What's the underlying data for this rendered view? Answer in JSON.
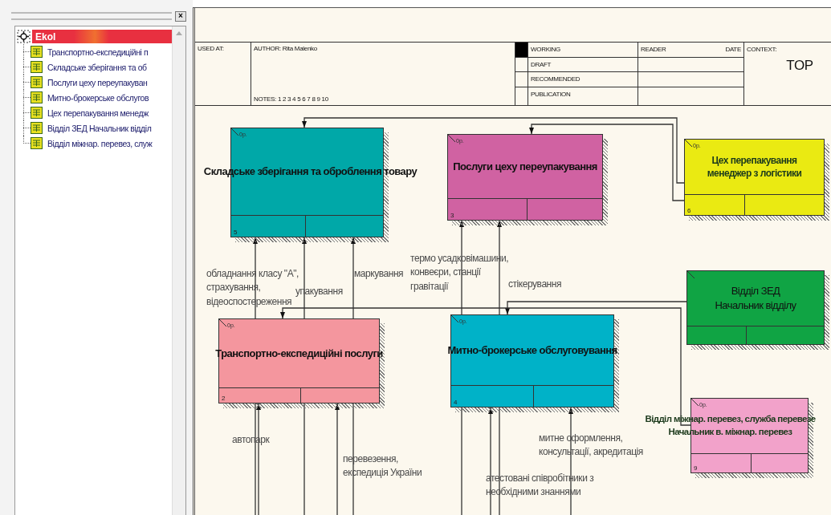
{
  "panel": {
    "close_glyph": "×"
  },
  "tree": {
    "root": {
      "label": "Ekol",
      "selected": true
    },
    "items": [
      {
        "label": "Транспортно-експедиційні п",
        "selected": false
      },
      {
        "label": "Складське зберігання та об",
        "selected": false
      },
      {
        "label": "Послуги цеху переупакуван",
        "selected": false
      },
      {
        "label": "Митно-брокерське обслугов",
        "selected": false
      },
      {
        "label": "Цех перепакування менедж",
        "selected": false
      },
      {
        "label": "Відділ ЗЕД Начальник відділ",
        "selected": false
      },
      {
        "label": "Відділ міжнар. перевез, служ",
        "selected": false
      }
    ]
  },
  "header": {
    "used_at": "USED AT:",
    "author": "AUTHOR:  Rita Malenko",
    "notes": "NOTES:  1 2 3 4 5 6 7 8 9 10",
    "statuses": [
      {
        "label": "WORKING",
        "selected": true
      },
      {
        "label": "DRAFT",
        "selected": false
      },
      {
        "label": "RECOMMENDED",
        "selected": false
      },
      {
        "label": "PUBLICATION",
        "selected": false
      }
    ],
    "reader": "READER",
    "date": "DATE",
    "context": "CONTEXT:",
    "context_value": "TOP"
  },
  "boxes": [
    {
      "title": "Складське зберігання та оброблення товару",
      "ref": "0р.",
      "number": "5",
      "color": "#00a8a8",
      "emphasis": true
    },
    {
      "title": "Послуги цеху переупакування",
      "ref": "0р.",
      "number": "3",
      "color": "#d062a2",
      "emphasis": true
    },
    {
      "title": "Цех перепакування\nменеджер з логістики",
      "ref": "0р.",
      "number": "6",
      "color": "#eaea12",
      "emphasis": true
    },
    {
      "title": "Відділ ЗЕД\nНачальник відділу",
      "color": "#10a444",
      "emphasis": false
    },
    {
      "title": "Транспортно-експедиційні послуги",
      "ref": "0р.",
      "number": "2",
      "color": "#f4969e",
      "emphasis": true
    },
    {
      "title": "Митно-брокерське обслуговування",
      "ref": "0р.",
      "number": "4",
      "color": "#00b2c8",
      "emphasis": true
    },
    {
      "title": "Відділ міжнар. перевез, служба перевезе\nНачальник в. міжнар. перевез",
      "ref": "0р.",
      "number": "9",
      "color": "#f2a2ca",
      "emphasis": true
    }
  ],
  "arrow_labels": [
    {
      "text": "обладнання класу \"А\",\nстрахування,\nвідеоспостереження"
    },
    {
      "text": "упакування"
    },
    {
      "text": "маркування"
    },
    {
      "text": "термо усадковімашини,\nконвеєри, станції\nгравітації"
    },
    {
      "text": "стікерування"
    },
    {
      "text": "автопарк"
    },
    {
      "text": "перевезення,\nекспедиція України"
    },
    {
      "text": "атестовані співробітники з\nнеобхідними знаннями"
    },
    {
      "text": "митне оформлення,\nконсультації, акредитація"
    }
  ]
}
